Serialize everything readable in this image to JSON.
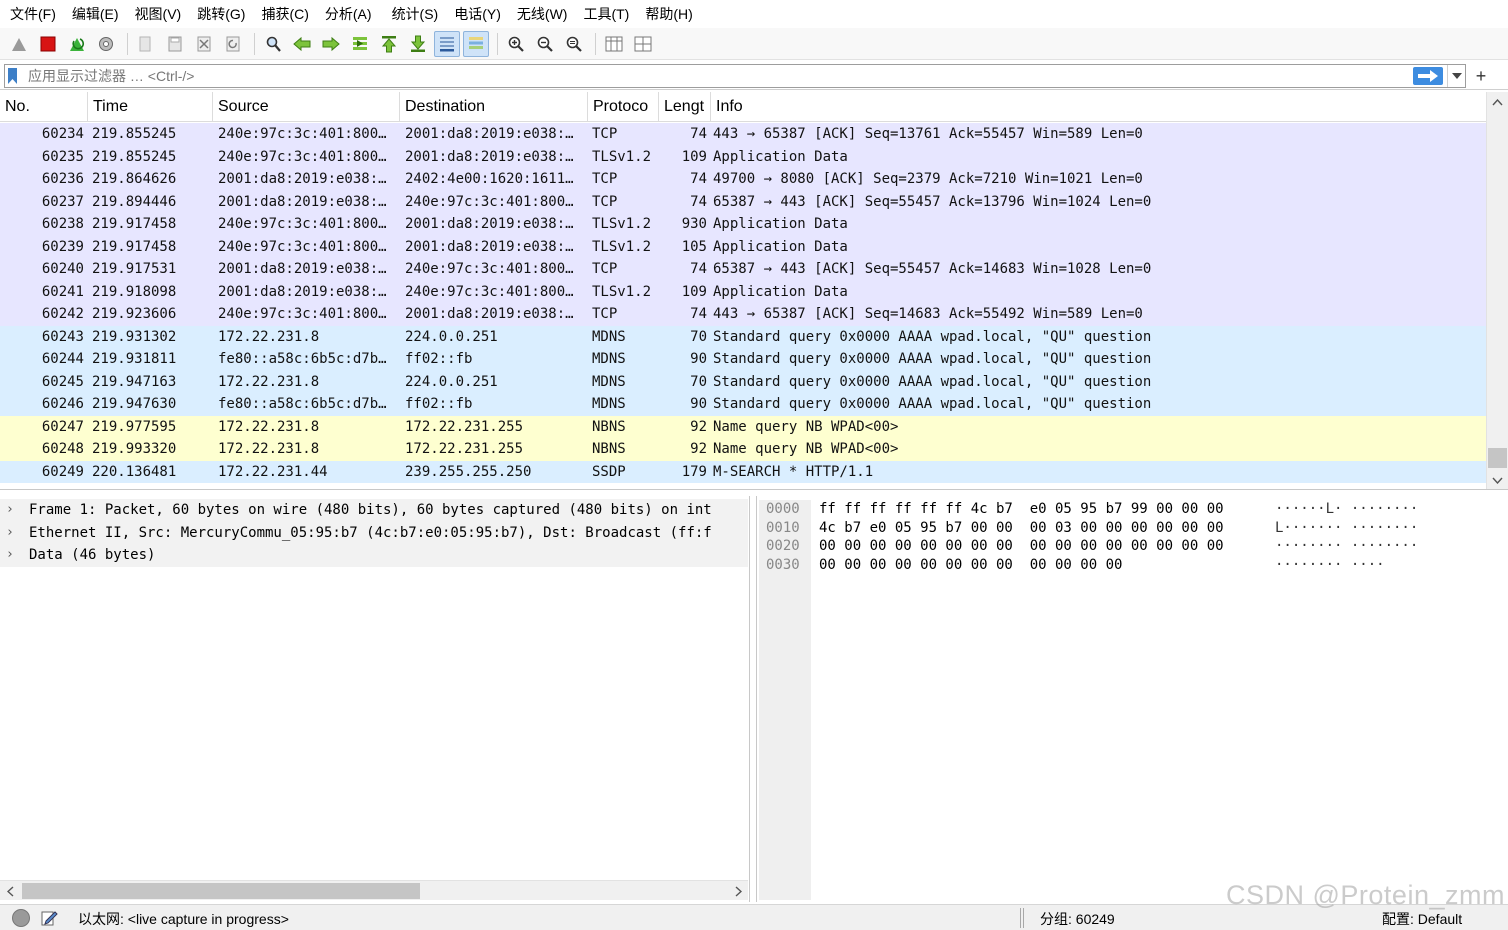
{
  "menu": [
    "文件(F)",
    "编辑(E)",
    "视图(V)",
    "跳转(G)",
    "捕获(C)",
    "分析(A)",
    "统计(S)",
    "电话(Y)",
    "无线(W)",
    "工具(T)",
    "帮助(H)"
  ],
  "toolbar": {
    "icons": [
      "shark-fin-start-icon",
      "stop-capture-icon",
      "restart-capture-icon",
      "capture-options-icon",
      "open-file-icon",
      "save-file-icon",
      "close-file-icon",
      "reload-file-icon",
      "find-packet-icon",
      "go-back-icon",
      "go-forward-icon",
      "go-to-packet-icon",
      "first-packet-icon",
      "last-packet-icon",
      "auto-scroll-icon",
      "colorize-icon",
      "zoom-in-icon",
      "zoom-out-icon",
      "zoom-normal-icon",
      "resize-columns-icon",
      "layout-icon"
    ],
    "active": [
      "auto-scroll-icon",
      "colorize-icon"
    ]
  },
  "filter": {
    "placeholder": "应用显示过滤器 … <Ctrl-/>"
  },
  "packet_list": {
    "columns": [
      "No.",
      "Time",
      "Source",
      "Destination",
      "Protoco",
      "Lengt",
      "Info"
    ],
    "rows": [
      {
        "no": "60234",
        "time": "219.855245",
        "src": "240e:97c:3c:401:800…",
        "dst": "2001:da8:2019:e038:…",
        "proto": "TCP",
        "len": "74",
        "info": "443 → 65387 [ACK] Seq=13761 Ack=55457 Win=589 Len=0",
        "color": "tcp"
      },
      {
        "no": "60235",
        "time": "219.855245",
        "src": "240e:97c:3c:401:800…",
        "dst": "2001:da8:2019:e038:…",
        "proto": "TLSv1.2",
        "len": "109",
        "info": "Application Data",
        "color": "tcp"
      },
      {
        "no": "60236",
        "time": "219.864626",
        "src": "2001:da8:2019:e038:…",
        "dst": "2402:4e00:1620:1611…",
        "proto": "TCP",
        "len": "74",
        "info": "49700 → 8080 [ACK] Seq=2379 Ack=7210 Win=1021 Len=0",
        "color": "tcp"
      },
      {
        "no": "60237",
        "time": "219.894446",
        "src": "2001:da8:2019:e038:…",
        "dst": "240e:97c:3c:401:800…",
        "proto": "TCP",
        "len": "74",
        "info": "65387 → 443 [ACK] Seq=55457 Ack=13796 Win=1024 Len=0",
        "color": "tcp"
      },
      {
        "no": "60238",
        "time": "219.917458",
        "src": "240e:97c:3c:401:800…",
        "dst": "2001:da8:2019:e038:…",
        "proto": "TLSv1.2",
        "len": "930",
        "info": "Application Data",
        "color": "tcp"
      },
      {
        "no": "60239",
        "time": "219.917458",
        "src": "240e:97c:3c:401:800…",
        "dst": "2001:da8:2019:e038:…",
        "proto": "TLSv1.2",
        "len": "105",
        "info": "Application Data",
        "color": "tcp"
      },
      {
        "no": "60240",
        "time": "219.917531",
        "src": "2001:da8:2019:e038:…",
        "dst": "240e:97c:3c:401:800…",
        "proto": "TCP",
        "len": "74",
        "info": "65387 → 443 [ACK] Seq=55457 Ack=14683 Win=1028 Len=0",
        "color": "tcp"
      },
      {
        "no": "60241",
        "time": "219.918098",
        "src": "2001:da8:2019:e038:…",
        "dst": "240e:97c:3c:401:800…",
        "proto": "TLSv1.2",
        "len": "109",
        "info": "Application Data",
        "color": "tcp"
      },
      {
        "no": "60242",
        "time": "219.923606",
        "src": "240e:97c:3c:401:800…",
        "dst": "2001:da8:2019:e038:…",
        "proto": "TCP",
        "len": "74",
        "info": "443 → 65387 [ACK] Seq=14683 Ack=55492 Win=589 Len=0",
        "color": "tcp"
      },
      {
        "no": "60243",
        "time": "219.931302",
        "src": "172.22.231.8",
        "dst": "224.0.0.251",
        "proto": "MDNS",
        "len": "70",
        "info": "Standard query 0x0000 AAAA wpad.local, \"QU\" question",
        "color": "udp"
      },
      {
        "no": "60244",
        "time": "219.931811",
        "src": "fe80::a58c:6b5c:d7b…",
        "dst": "ff02::fb",
        "proto": "MDNS",
        "len": "90",
        "info": "Standard query 0x0000 AAAA wpad.local, \"QU\" question",
        "color": "udp"
      },
      {
        "no": "60245",
        "time": "219.947163",
        "src": "172.22.231.8",
        "dst": "224.0.0.251",
        "proto": "MDNS",
        "len": "70",
        "info": "Standard query 0x0000 AAAA wpad.local, \"QU\" question",
        "color": "udp"
      },
      {
        "no": "60246",
        "time": "219.947630",
        "src": "fe80::a58c:6b5c:d7b…",
        "dst": "ff02::fb",
        "proto": "MDNS",
        "len": "90",
        "info": "Standard query 0x0000 AAAA wpad.local, \"QU\" question",
        "color": "udp"
      },
      {
        "no": "60247",
        "time": "219.977595",
        "src": "172.22.231.8",
        "dst": "172.22.231.255",
        "proto": "NBNS",
        "len": "92",
        "info": "Name query NB WPAD<00>",
        "color": "nbns"
      },
      {
        "no": "60248",
        "time": "219.993320",
        "src": "172.22.231.8",
        "dst": "172.22.231.255",
        "proto": "NBNS",
        "len": "92",
        "info": "Name query NB WPAD<00>",
        "color": "nbns"
      },
      {
        "no": "60249",
        "time": "220.136481",
        "src": "172.22.231.44",
        "dst": "239.255.255.250",
        "proto": "SSDP",
        "len": "179",
        "info": "M-SEARCH * HTTP/1.1",
        "color": "udp"
      }
    ]
  },
  "details": [
    "Frame 1: Packet, 60 bytes on wire (480 bits), 60 bytes captured (480 bits) on int",
    "Ethernet II, Src: MercuryCommu_05:95:b7 (4c:b7:e0:05:95:b7), Dst: Broadcast (ff:f",
    "Data (46 bytes)"
  ],
  "bytes": [
    {
      "offset": "0000",
      "hex": "ff ff ff ff ff ff 4c b7  e0 05 95 b7 99 00 00 00",
      "ascii": "······L· ········"
    },
    {
      "offset": "0010",
      "hex": "4c b7 e0 05 95 b7 00 00  00 03 00 00 00 00 00 00",
      "ascii": "L······· ········"
    },
    {
      "offset": "0020",
      "hex": "00 00 00 00 00 00 00 00  00 00 00 00 00 00 00 00",
      "ascii": "········ ········"
    },
    {
      "offset": "0030",
      "hex": "00 00 00 00 00 00 00 00  00 00 00 00",
      "ascii": "········ ····"
    }
  ],
  "status": {
    "capture_text": "以太网: <live capture in progress>",
    "packets_text": "分组: 60249",
    "profile_text": "配置: Default",
    "watermark": "CSDN @Protein_zmm"
  }
}
